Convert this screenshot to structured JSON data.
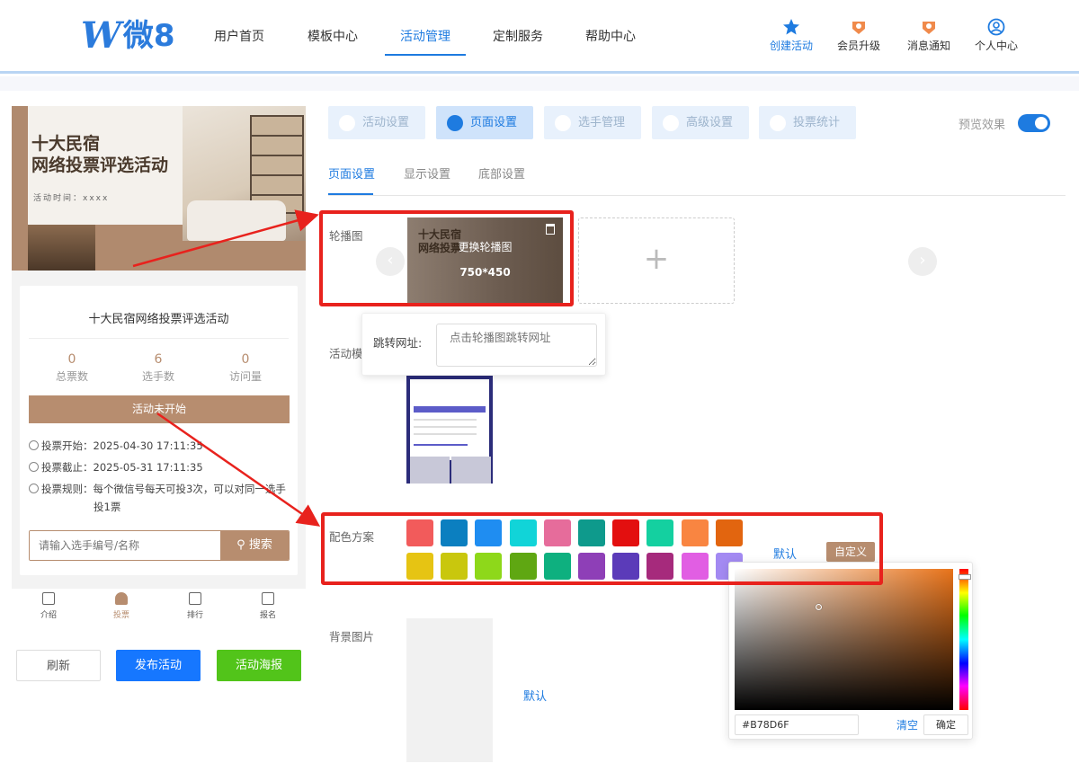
{
  "logo": {
    "mark": "W",
    "text": "微8"
  },
  "nav": [
    "用户首页",
    "模板中心",
    "活动管理",
    "定制服务",
    "帮助中心"
  ],
  "top_icons": [
    "创建活动",
    "会员升级",
    "消息通知",
    "个人中心"
  ],
  "preview": {
    "banner_title_1": "十大民宿",
    "banner_title_2": "网络投票评选活动",
    "banner_date": "活动时间：xxxx",
    "title": "十大民宿网络投票评选活动",
    "stats": [
      {
        "value": "0",
        "label": "总票数"
      },
      {
        "value": "6",
        "label": "选手数"
      },
      {
        "value": "0",
        "label": "访问量"
      }
    ],
    "status_button": "活动未开始",
    "vote_start": "投票开始：2025-04-30 17:11:35",
    "vote_end": "投票截止：2025-05-31 17:11:35",
    "rule_1": "投票规则：每个微信号每天可投3次，可以对同一选手",
    "rule_2": "投1票",
    "search_placeholder": "请输入选手编号/名称",
    "search_button": "搜索",
    "tabbar": [
      "介绍",
      "投票",
      "排行",
      "报名"
    ]
  },
  "left_buttons": [
    "刷新",
    "发布活动",
    "活动海报"
  ],
  "top_tabs": [
    "活动设置",
    "页面设置",
    "选手管理",
    "高级设置",
    "投票统计"
  ],
  "preview_toggle_label": "预览效果",
  "sub_tabs": [
    "页面设置",
    "显示设置",
    "底部设置"
  ],
  "fields": {
    "carousel": "轮播图",
    "template": "活动模",
    "colors": "配色方案",
    "background": "背景图片"
  },
  "slide": {
    "title_1": "十大民宿",
    "title_2": "网络投票",
    "replace": "更换轮播图",
    "size": "750*450",
    "add": "+"
  },
  "popup": {
    "label": "跳转网址:",
    "placeholder": "点击轮播图跳转网址"
  },
  "colors": {
    "row1": [
      "#f25b5b",
      "#0b7fc0",
      "#1f8df1",
      "#11d4d8",
      "#e66c9b",
      "#0e9a8c",
      "#e30f0f",
      "#14d0a0",
      "#f98541",
      "#e2650f"
    ],
    "row2": [
      "#e6c413",
      "#c9c70d",
      "#8ed81a",
      "#5fa712",
      "#0eb07f",
      "#8e3fb7",
      "#5b3bb9",
      "#a62a7c",
      "#e15ee3",
      "#a38af2"
    ],
    "default_label": "默认",
    "custom_label": "自定义"
  },
  "background": {
    "default_label": "默认"
  },
  "picker": {
    "hex": "#B78D6F",
    "clear": "清空",
    "ok": "确定"
  },
  "accent": "#1e7be0",
  "brand": "#b78d6f"
}
